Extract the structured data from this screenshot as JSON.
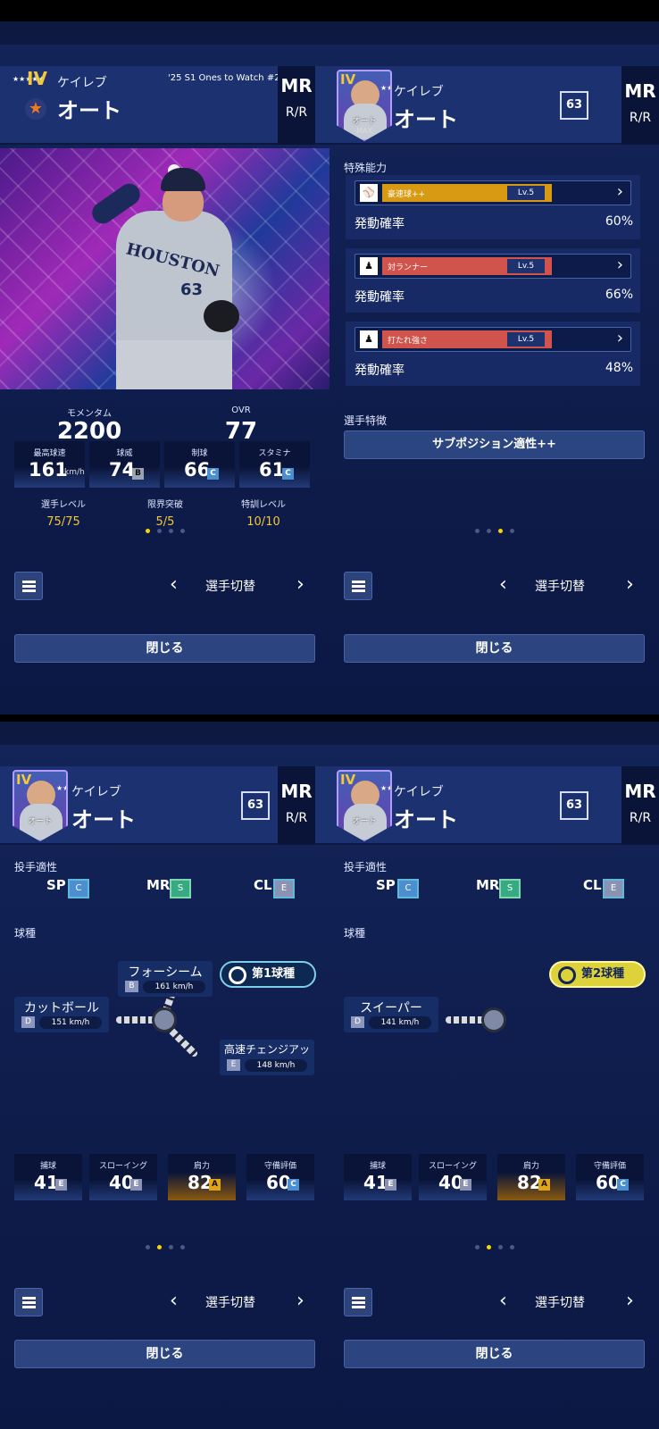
{
  "player": {
    "first": "ケイレブ",
    "last": "オート",
    "number": "63",
    "pos": "MR",
    "hand": "R/R",
    "rank": "IV",
    "series": "'25 S1 Ones to Watch #2",
    "card_name": "オート",
    "card_max": "MAX",
    "jersey_text": "HOUSTON",
    "jersey_number": "63"
  },
  "p1": {
    "moment_label": "モメンタム",
    "moment": "2200",
    "ovr_label": "OVR",
    "ovr": "77",
    "stats": [
      {
        "label": "最高球速",
        "value": "161",
        "unit": "km/h",
        "grade": ""
      },
      {
        "label": "球威",
        "value": "74",
        "unit": "",
        "grade": "B"
      },
      {
        "label": "制球",
        "value": "66",
        "unit": "",
        "grade": "C"
      },
      {
        "label": "スタミナ",
        "value": "61",
        "unit": "",
        "grade": "C"
      }
    ],
    "levels": [
      {
        "label": "選手レベル",
        "value": "75/75"
      },
      {
        "label": "限界突破",
        "value": "5/5"
      },
      {
        "label": "特訓レベル",
        "value": "10/10"
      }
    ]
  },
  "p2": {
    "special_title": "特殊能力",
    "abilities": [
      {
        "name": "豪速球++",
        "lv": "Lv.5",
        "rate_label": "発動確率",
        "rate": "60%",
        "color": "#d79a12"
      },
      {
        "name": "対ランナー",
        "lv": "Lv.5",
        "rate_label": "発動確率",
        "rate": "66%",
        "color": "#d0534c"
      },
      {
        "name": "打たれ強さ",
        "lv": "Lv.5",
        "rate_label": "発動確率",
        "rate": "48%",
        "color": "#d0534c"
      }
    ],
    "trait_title": "選手特徴",
    "trait": "サブポジション適性++"
  },
  "aptitude": {
    "title": "投手適性",
    "items": [
      {
        "pos": "SP",
        "grade": "C"
      },
      {
        "pos": "MR",
        "grade": "S"
      },
      {
        "pos": "CL",
        "grade": "E"
      }
    ]
  },
  "pitches_title": "球種",
  "p3": {
    "badge": "第1球種",
    "pitches": [
      {
        "name": "フォーシーム",
        "grade": "B",
        "speed": "161 km/h"
      },
      {
        "name": "カットボール",
        "grade": "D",
        "speed": "151 km/h"
      },
      {
        "name": "高速チェンジアップ",
        "grade": "E",
        "speed": "148 km/h"
      }
    ]
  },
  "p4": {
    "badge": "第2球種",
    "pitches": [
      {
        "name": "スイーパー",
        "grade": "D",
        "speed": "141 km/h"
      }
    ]
  },
  "defense": [
    {
      "label": "捕球",
      "value": "41",
      "grade": "E"
    },
    {
      "label": "スローイング",
      "value": "40",
      "grade": "E"
    },
    {
      "label": "肩力",
      "value": "82",
      "grade": "A"
    },
    {
      "label": "守備評価",
      "value": "60",
      "grade": "C"
    }
  ],
  "nav": {
    "switch": "選手切替",
    "close": "閉じる",
    "prev": "‹",
    "next": "›"
  },
  "pages": [
    1,
    3,
    2,
    2
  ]
}
